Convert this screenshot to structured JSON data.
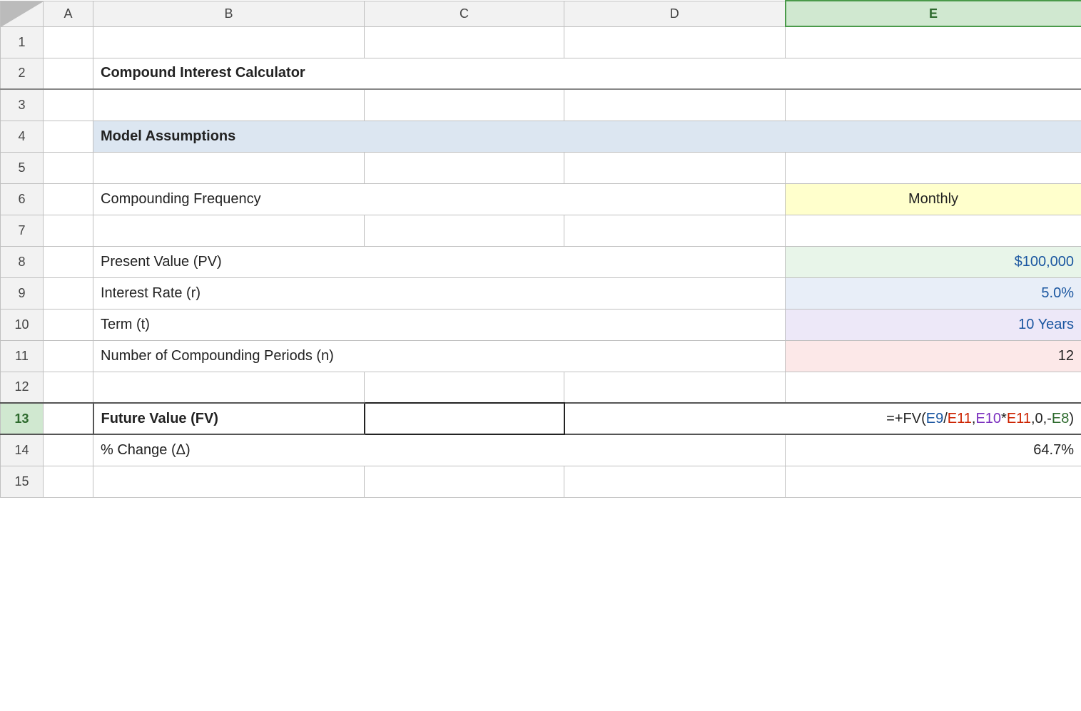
{
  "columns": {
    "rowHeader": "",
    "a": "A",
    "b": "B",
    "c": "C",
    "d": "D",
    "e": "E"
  },
  "rows": {
    "r1": {
      "num": "1"
    },
    "r2": {
      "num": "2",
      "title": "Compound Interest Calculator"
    },
    "r3": {
      "num": "3"
    },
    "r4": {
      "num": "4",
      "sectionHeader": "Model Assumptions"
    },
    "r5": {
      "num": "5"
    },
    "r6": {
      "num": "6",
      "label": "Compounding Frequency",
      "value": "Monthly"
    },
    "r7": {
      "num": "7"
    },
    "r8": {
      "num": "8",
      "label": "Present Value (PV)",
      "value": "$100,000"
    },
    "r9": {
      "num": "9",
      "label": "Interest Rate (r)",
      "value": "5.0%"
    },
    "r10": {
      "num": "10",
      "label": "Term (t)",
      "value": "10 Years"
    },
    "r11": {
      "num": "11",
      "label": "Number of Compounding Periods (n)",
      "value": "12"
    },
    "r12": {
      "num": "12"
    },
    "r13": {
      "num": "13",
      "labelB": "Future Value (FV)"
    },
    "r14": {
      "num": "14",
      "label": "% Change (Δ)",
      "value": "64.7%"
    },
    "r15": {
      "num": "15"
    }
  },
  "formula": {
    "prefix": "=+FV(",
    "part1": "E9",
    "slash": "/",
    "part2": "E11",
    "comma1": ",",
    "part3": "E10",
    "star": "*",
    "part4": "E11",
    "suffix": ",0,-",
    "part5": "E8",
    "close": ")"
  }
}
